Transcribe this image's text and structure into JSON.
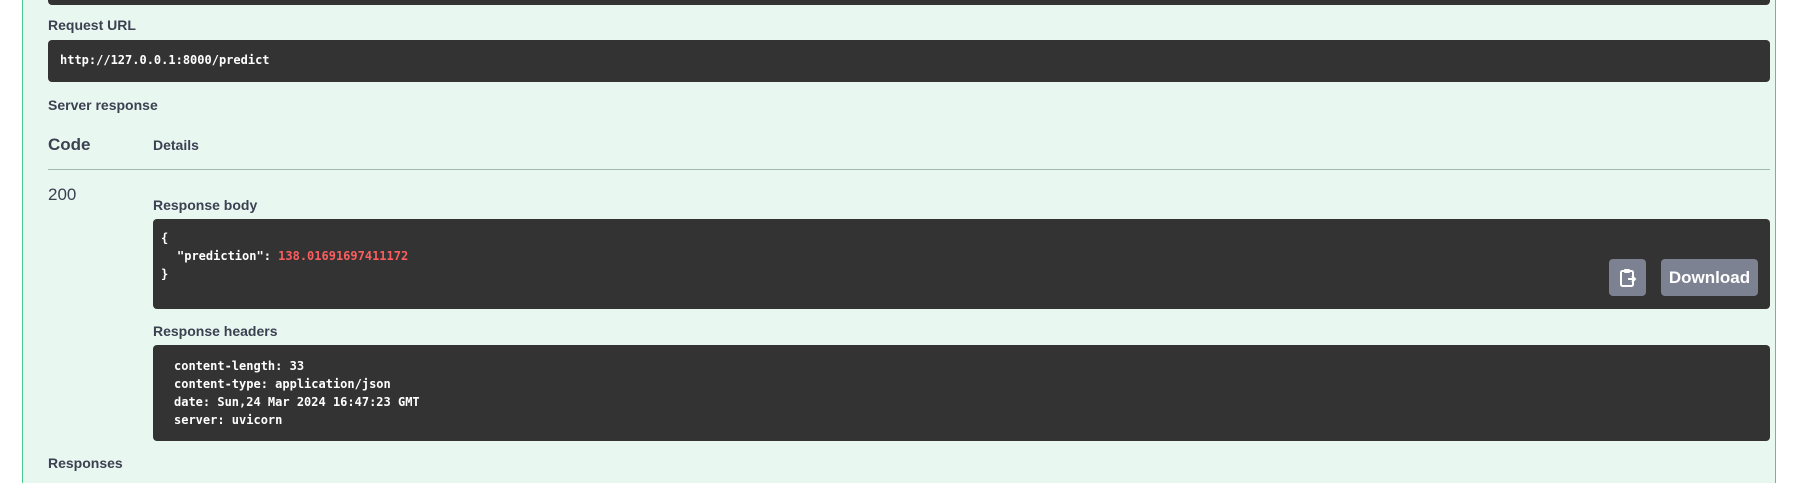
{
  "request_url": {
    "label": "Request URL",
    "value": "http://127.0.0.1:8000/predict"
  },
  "server_response": {
    "label": "Server response",
    "columns": {
      "code": "Code",
      "details": "Details"
    },
    "status_code": "200",
    "response_body": {
      "label": "Response body",
      "open_brace": "{",
      "key": "\"prediction\"",
      "separator": ": ",
      "value": "138.01691697411172",
      "close_brace": "}"
    },
    "response_headers": {
      "label": "Response headers",
      "lines": [
        "content-length: 33",
        "content-type: application/json",
        "date: Sun,24 Mar 2024 16:47:23 GMT",
        "server: uvicorn"
      ]
    },
    "download_label": "Download",
    "copy_icon": "clipboard-icon"
  },
  "responses_label": "Responses"
}
